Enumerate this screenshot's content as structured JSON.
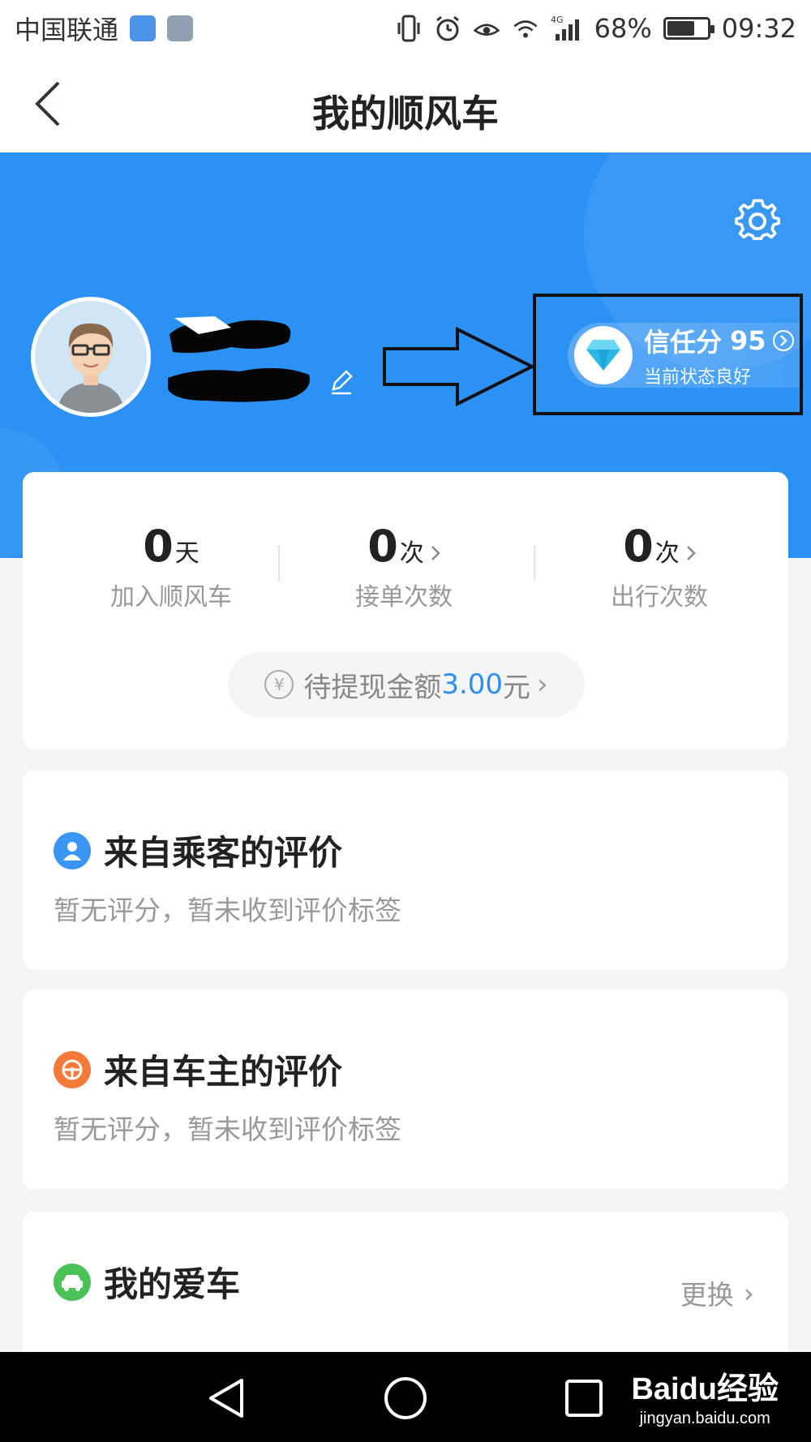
{
  "status_bar": {
    "carrier": "中国联通",
    "battery_percent": "68%",
    "battery_level": 0.68,
    "network": "4G",
    "time": "09:32"
  },
  "header": {
    "title": "我的顺风车"
  },
  "profile": {
    "trust": {
      "label": "信任分",
      "score": "95",
      "status": "当前状态良好"
    }
  },
  "stats": [
    {
      "value": "0",
      "unit": "天",
      "label": "加入顺风车",
      "has_arrow": false
    },
    {
      "value": "0",
      "unit": "次",
      "label": "接单次数",
      "has_arrow": true
    },
    {
      "value": "0",
      "unit": "次",
      "label": "出行次数",
      "has_arrow": true
    }
  ],
  "withdraw": {
    "icon_text": "¥",
    "prefix": "待提现金额",
    "amount": "3.00",
    "suffix": "元",
    "chevron": "›"
  },
  "reviews": {
    "passenger": {
      "title": "来自乘客的评价",
      "desc": "暂无评分，暂未收到评价标签"
    },
    "driver": {
      "title": "来自车主的评价",
      "desc": "暂无评分，暂未收到评价标签"
    }
  },
  "car": {
    "title": "我的爱车",
    "change_label": "更换",
    "chevron": "›"
  },
  "watermark": {
    "logo": "Baidu经验",
    "url": "jingyan.baidu.com"
  },
  "colors": {
    "hero_blue": "#2b91f5",
    "accent_blue": "#2b8ff2",
    "passenger_icon": "#3996f5",
    "driver_icon": "#f57a3a",
    "car_icon": "#4bc257"
  }
}
